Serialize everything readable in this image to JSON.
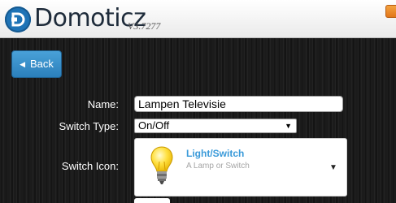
{
  "header": {
    "app_name": "Domoticz",
    "version": "V3.7277"
  },
  "toolbar": {
    "back_label": "Back"
  },
  "form": {
    "name_label": "Name:",
    "name_value": "Lampen Televisie",
    "switch_type_label": "Switch Type:",
    "switch_type_value": "On/Off",
    "switch_icon_label": "Switch Icon:",
    "switch_icon": {
      "title": "Light/Switch",
      "description": "A Lamp or Switch",
      "icon": "lightbulb-icon"
    }
  },
  "colors": {
    "accent_blue": "#3a9ad9",
    "back_button": "#2b7fbb",
    "logo_blue": "#1e73b6",
    "orange": "#e2761a"
  }
}
